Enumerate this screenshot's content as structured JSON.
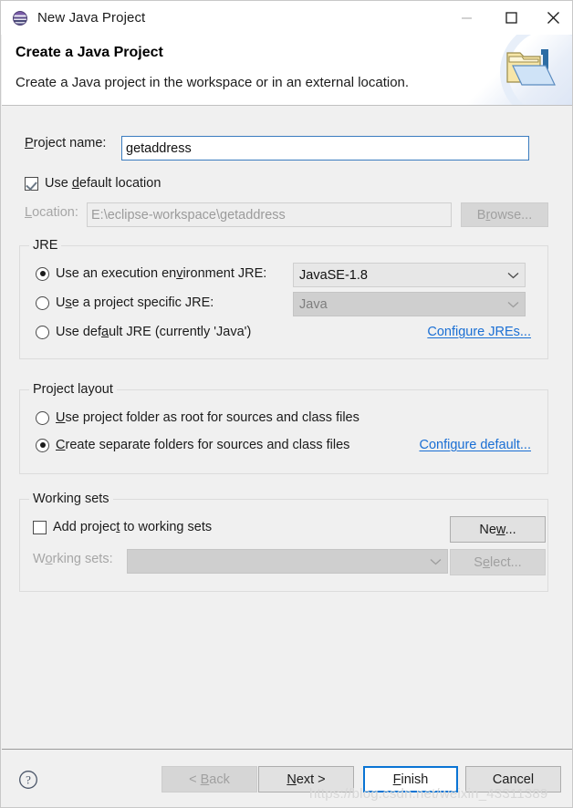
{
  "window": {
    "title": "New Java Project",
    "icon": "eclipse-globe-icon",
    "controls": {
      "minimize": "minimize-icon",
      "maximize": "maximize-icon",
      "close": "close-icon"
    }
  },
  "header": {
    "title": "Create a Java Project",
    "subtitle": "Create a Java project in the workspace or in an external location.",
    "banner_icon": "java-folder-icon"
  },
  "form": {
    "project_name": {
      "label": "Project name:",
      "mnemonic": "P",
      "value": "getaddress",
      "placeholder": ""
    },
    "use_default_location": {
      "label": "Use default location",
      "mnemonic": "d",
      "checked": true
    },
    "location": {
      "label": "Location:",
      "mnemonic": "L",
      "value": "E:\\eclipse-workspace\\getaddress",
      "enabled": false
    },
    "browse_button": {
      "label": "Browse...",
      "mnemonic": "r",
      "enabled": false
    }
  },
  "jre": {
    "group_title": "JRE",
    "options": [
      {
        "label": "Use an execution environment JRE:",
        "mnemonic": "v",
        "selected": true,
        "combo_value": "JavaSE-1.8",
        "combo_enabled": true
      },
      {
        "label": "Use a project specific JRE:",
        "mnemonic": "s",
        "selected": false,
        "combo_value": "Java",
        "combo_enabled": false
      },
      {
        "label": "Use default JRE (currently 'Java')",
        "mnemonic": "a",
        "selected": false
      }
    ],
    "configure_link": "Configure JREs..."
  },
  "project_layout": {
    "group_title": "Project layout",
    "options": [
      {
        "label": "Use project folder as root for sources and class files",
        "mnemonic": "U",
        "selected": false
      },
      {
        "label": "Create separate folders for sources and class files",
        "mnemonic": "C",
        "selected": true
      }
    ],
    "configure_link": "Configure default..."
  },
  "working_sets": {
    "group_title": "Working sets",
    "add_checkbox": {
      "label": "Add project to working sets",
      "mnemonic": "t",
      "checked": false
    },
    "new_button": {
      "label": "New...",
      "mnemonic": "w",
      "enabled": true
    },
    "sets_label": {
      "label": "Working sets:",
      "mnemonic": "o",
      "enabled": false
    },
    "sets_combo": {
      "value": "",
      "enabled": false
    },
    "select_button": {
      "label": "Select...",
      "mnemonic": "e",
      "enabled": false
    }
  },
  "footer": {
    "help_icon": "help-question-icon",
    "buttons": [
      {
        "label": "< Back",
        "mnemonic": "B",
        "enabled": false,
        "default": false
      },
      {
        "label": "Next >",
        "mnemonic": "N",
        "enabled": true,
        "default": false
      },
      {
        "label": "Finish",
        "mnemonic": "F",
        "enabled": true,
        "default": true
      },
      {
        "label": "Cancel",
        "mnemonic": "",
        "enabled": true,
        "default": false
      }
    ]
  },
  "watermark": {
    "text": "https://blog.csdn.net/weixin_43311389"
  },
  "colors": {
    "accent": "#0a74d4",
    "link": "#1a6fd4",
    "dialog_bg": "#f0f0f0",
    "field_border_focus": "#3a7cbf"
  }
}
